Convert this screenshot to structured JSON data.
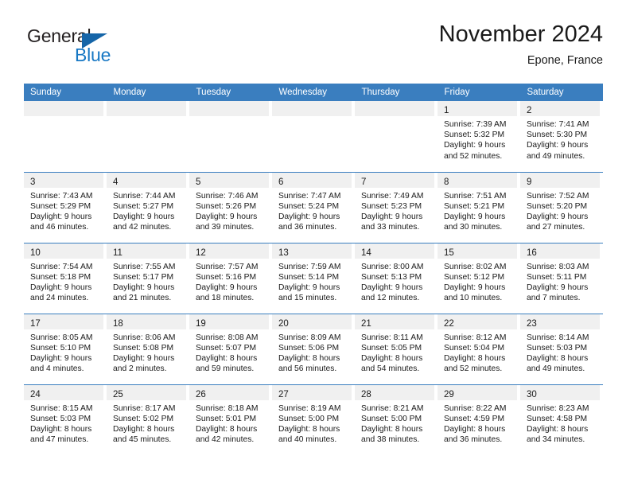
{
  "brand": {
    "word_one": "General",
    "word_two": "Blue",
    "triangle_icon": "triangle-icon",
    "color_dark": "#231f20",
    "color_blue": "#1878c4"
  },
  "header": {
    "title": "November 2024",
    "subtitle": "Epone, France"
  },
  "theme": {
    "header_blue": "#3a7ebf",
    "daynum_band": "#f0f0f0",
    "cell_background": "#ffffff",
    "text": "#1a1a1a"
  },
  "weekdays": [
    "Sunday",
    "Monday",
    "Tuesday",
    "Wednesday",
    "Thursday",
    "Friday",
    "Saturday"
  ],
  "weeks": [
    [
      {
        "day": "",
        "lines": []
      },
      {
        "day": "",
        "lines": []
      },
      {
        "day": "",
        "lines": []
      },
      {
        "day": "",
        "lines": []
      },
      {
        "day": "",
        "lines": []
      },
      {
        "day": "1",
        "lines": [
          "Sunrise: 7:39 AM",
          "Sunset: 5:32 PM",
          "Daylight: 9 hours",
          "and 52 minutes."
        ]
      },
      {
        "day": "2",
        "lines": [
          "Sunrise: 7:41 AM",
          "Sunset: 5:30 PM",
          "Daylight: 9 hours",
          "and 49 minutes."
        ]
      }
    ],
    [
      {
        "day": "3",
        "lines": [
          "Sunrise: 7:43 AM",
          "Sunset: 5:29 PM",
          "Daylight: 9 hours",
          "and 46 minutes."
        ]
      },
      {
        "day": "4",
        "lines": [
          "Sunrise: 7:44 AM",
          "Sunset: 5:27 PM",
          "Daylight: 9 hours",
          "and 42 minutes."
        ]
      },
      {
        "day": "5",
        "lines": [
          "Sunrise: 7:46 AM",
          "Sunset: 5:26 PM",
          "Daylight: 9 hours",
          "and 39 minutes."
        ]
      },
      {
        "day": "6",
        "lines": [
          "Sunrise: 7:47 AM",
          "Sunset: 5:24 PM",
          "Daylight: 9 hours",
          "and 36 minutes."
        ]
      },
      {
        "day": "7",
        "lines": [
          "Sunrise: 7:49 AM",
          "Sunset: 5:23 PM",
          "Daylight: 9 hours",
          "and 33 minutes."
        ]
      },
      {
        "day": "8",
        "lines": [
          "Sunrise: 7:51 AM",
          "Sunset: 5:21 PM",
          "Daylight: 9 hours",
          "and 30 minutes."
        ]
      },
      {
        "day": "9",
        "lines": [
          "Sunrise: 7:52 AM",
          "Sunset: 5:20 PM",
          "Daylight: 9 hours",
          "and 27 minutes."
        ]
      }
    ],
    [
      {
        "day": "10",
        "lines": [
          "Sunrise: 7:54 AM",
          "Sunset: 5:18 PM",
          "Daylight: 9 hours",
          "and 24 minutes."
        ]
      },
      {
        "day": "11",
        "lines": [
          "Sunrise: 7:55 AM",
          "Sunset: 5:17 PM",
          "Daylight: 9 hours",
          "and 21 minutes."
        ]
      },
      {
        "day": "12",
        "lines": [
          "Sunrise: 7:57 AM",
          "Sunset: 5:16 PM",
          "Daylight: 9 hours",
          "and 18 minutes."
        ]
      },
      {
        "day": "13",
        "lines": [
          "Sunrise: 7:59 AM",
          "Sunset: 5:14 PM",
          "Daylight: 9 hours",
          "and 15 minutes."
        ]
      },
      {
        "day": "14",
        "lines": [
          "Sunrise: 8:00 AM",
          "Sunset: 5:13 PM",
          "Daylight: 9 hours",
          "and 12 minutes."
        ]
      },
      {
        "day": "15",
        "lines": [
          "Sunrise: 8:02 AM",
          "Sunset: 5:12 PM",
          "Daylight: 9 hours",
          "and 10 minutes."
        ]
      },
      {
        "day": "16",
        "lines": [
          "Sunrise: 8:03 AM",
          "Sunset: 5:11 PM",
          "Daylight: 9 hours",
          "and 7 minutes."
        ]
      }
    ],
    [
      {
        "day": "17",
        "lines": [
          "Sunrise: 8:05 AM",
          "Sunset: 5:10 PM",
          "Daylight: 9 hours",
          "and 4 minutes."
        ]
      },
      {
        "day": "18",
        "lines": [
          "Sunrise: 8:06 AM",
          "Sunset: 5:08 PM",
          "Daylight: 9 hours",
          "and 2 minutes."
        ]
      },
      {
        "day": "19",
        "lines": [
          "Sunrise: 8:08 AM",
          "Sunset: 5:07 PM",
          "Daylight: 8 hours",
          "and 59 minutes."
        ]
      },
      {
        "day": "20",
        "lines": [
          "Sunrise: 8:09 AM",
          "Sunset: 5:06 PM",
          "Daylight: 8 hours",
          "and 56 minutes."
        ]
      },
      {
        "day": "21",
        "lines": [
          "Sunrise: 8:11 AM",
          "Sunset: 5:05 PM",
          "Daylight: 8 hours",
          "and 54 minutes."
        ]
      },
      {
        "day": "22",
        "lines": [
          "Sunrise: 8:12 AM",
          "Sunset: 5:04 PM",
          "Daylight: 8 hours",
          "and 52 minutes."
        ]
      },
      {
        "day": "23",
        "lines": [
          "Sunrise: 8:14 AM",
          "Sunset: 5:03 PM",
          "Daylight: 8 hours",
          "and 49 minutes."
        ]
      }
    ],
    [
      {
        "day": "24",
        "lines": [
          "Sunrise: 8:15 AM",
          "Sunset: 5:03 PM",
          "Daylight: 8 hours",
          "and 47 minutes."
        ]
      },
      {
        "day": "25",
        "lines": [
          "Sunrise: 8:17 AM",
          "Sunset: 5:02 PM",
          "Daylight: 8 hours",
          "and 45 minutes."
        ]
      },
      {
        "day": "26",
        "lines": [
          "Sunrise: 8:18 AM",
          "Sunset: 5:01 PM",
          "Daylight: 8 hours",
          "and 42 minutes."
        ]
      },
      {
        "day": "27",
        "lines": [
          "Sunrise: 8:19 AM",
          "Sunset: 5:00 PM",
          "Daylight: 8 hours",
          "and 40 minutes."
        ]
      },
      {
        "day": "28",
        "lines": [
          "Sunrise: 8:21 AM",
          "Sunset: 5:00 PM",
          "Daylight: 8 hours",
          "and 38 minutes."
        ]
      },
      {
        "day": "29",
        "lines": [
          "Sunrise: 8:22 AM",
          "Sunset: 4:59 PM",
          "Daylight: 8 hours",
          "and 36 minutes."
        ]
      },
      {
        "day": "30",
        "lines": [
          "Sunrise: 8:23 AM",
          "Sunset: 4:58 PM",
          "Daylight: 8 hours",
          "and 34 minutes."
        ]
      }
    ]
  ]
}
